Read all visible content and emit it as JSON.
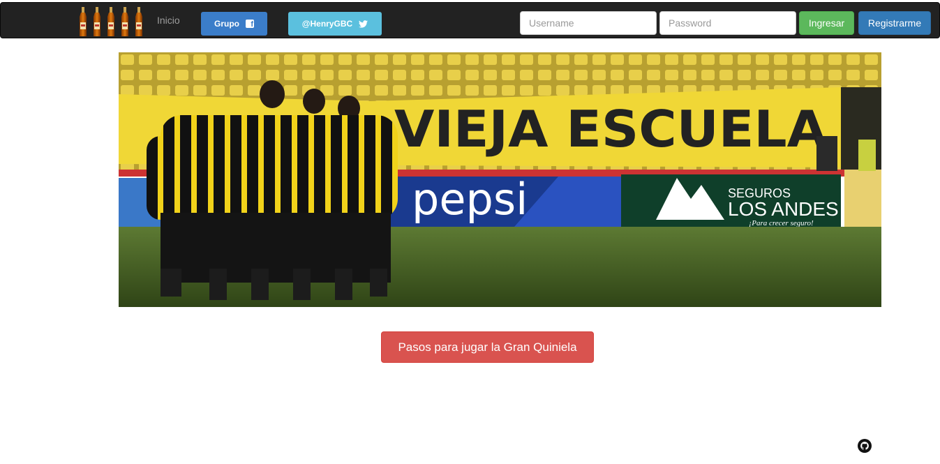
{
  "navbar": {
    "brand_icon": "beer-bottles-logo",
    "home_label": "Inicio",
    "group_label": "Grupo",
    "twitter_label": "@HenryGBC",
    "username_placeholder": "Username",
    "password_placeholder": "Password",
    "login_label": "Ingresar",
    "register_label": "Registrarme"
  },
  "hero": {
    "banner_text": "VIEJA ESCUELA",
    "sponsor_1": "pepsi",
    "sponsor_2_line1": "SEGUROS",
    "sponsor_2_line2": "LOS ANDES",
    "sponsor_2_tagline": "¡Para crecer seguro!"
  },
  "main": {
    "steps_button": "Pasos para jugar la Gran Quiniela"
  },
  "footer": {
    "github_icon": "github-icon"
  },
  "colors": {
    "navbar_bg": "#222222",
    "facebook": "#3b7dc9",
    "twitter": "#5bc0de",
    "success": "#5cb85c",
    "primary": "#337ab7",
    "danger": "#d9534f"
  }
}
